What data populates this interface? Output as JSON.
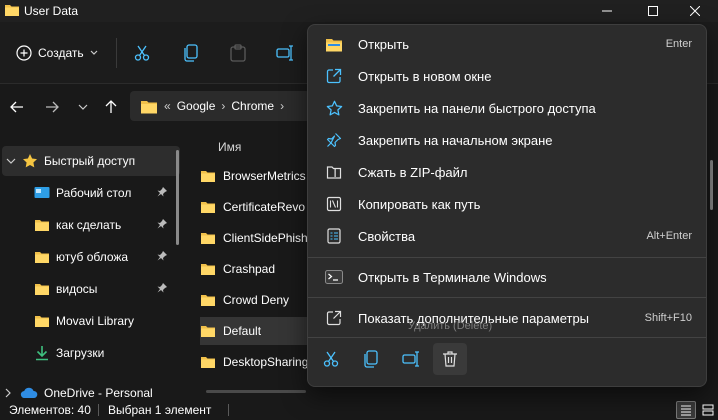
{
  "window": {
    "title": "User Data"
  },
  "toolbar": {
    "create_label": "Создать"
  },
  "address": {
    "prefix": "«",
    "crumbs": [
      "Google",
      "Chrome"
    ]
  },
  "sidebar": {
    "items": [
      {
        "label": "Быстрый доступ",
        "icon": "star-icon",
        "pinned": false,
        "selected": true
      },
      {
        "label": "Рабочий стол",
        "icon": "desktop-icon",
        "pinned": true
      },
      {
        "label": "как сделать",
        "icon": "folder-icon",
        "pinned": true
      },
      {
        "label": "ютуб обложа",
        "icon": "folder-icon",
        "pinned": true
      },
      {
        "label": "видосы",
        "icon": "folder-icon",
        "pinned": true
      },
      {
        "label": "Movavi Library",
        "icon": "folder-icon",
        "pinned": false
      },
      {
        "label": "Загрузки",
        "icon": "download-icon",
        "pinned": false
      },
      {
        "label": "OneDrive - Personal",
        "icon": "cloud-icon",
        "pinned": false
      }
    ]
  },
  "filelist": {
    "column_name": "Имя",
    "rows": [
      {
        "name": "BrowserMetrics",
        "selected": false
      },
      {
        "name": "CertificateRevo",
        "selected": false
      },
      {
        "name": "ClientSidePhish",
        "selected": false
      },
      {
        "name": "Crashpad",
        "selected": false
      },
      {
        "name": "Crowd Deny",
        "selected": false
      },
      {
        "name": "Default",
        "selected": true
      },
      {
        "name": "DesktopSharing",
        "selected": false
      }
    ]
  },
  "status": {
    "count": "Элементов: 40",
    "selection": "Выбран 1 элемент"
  },
  "context_menu": {
    "items": [
      {
        "label": "Открыть",
        "shortcut": "Enter",
        "icon": "folder-open-icon"
      },
      {
        "label": "Открыть в новом окне",
        "shortcut": "",
        "icon": "open-new-window-icon"
      },
      {
        "label": "Закрепить на панели быстрого доступа",
        "shortcut": "",
        "icon": "star-outline-icon"
      },
      {
        "label": "Закрепить на начальном экране",
        "shortcut": "",
        "icon": "pin-icon"
      },
      {
        "label": "Сжать в ZIP-файл",
        "shortcut": "",
        "icon": "zip-icon"
      },
      {
        "label": "Копировать как путь",
        "shortcut": "",
        "icon": "copy-path-icon"
      },
      {
        "label": "Свойства",
        "shortcut": "Alt+Enter",
        "icon": "properties-icon"
      },
      {
        "label": "Открыть в Терминале Windows",
        "shortcut": "",
        "icon": "terminal-icon"
      },
      {
        "label": "Показать дополнительные параметры",
        "shortcut": "Shift+F10",
        "icon": "more-options-icon"
      }
    ],
    "tooltip": "Удалить (Delete)"
  },
  "colors": {
    "accent": "#4cc2ff",
    "folder": "#f0c04a",
    "background": "#191919",
    "menu": "#2c2c2c"
  }
}
